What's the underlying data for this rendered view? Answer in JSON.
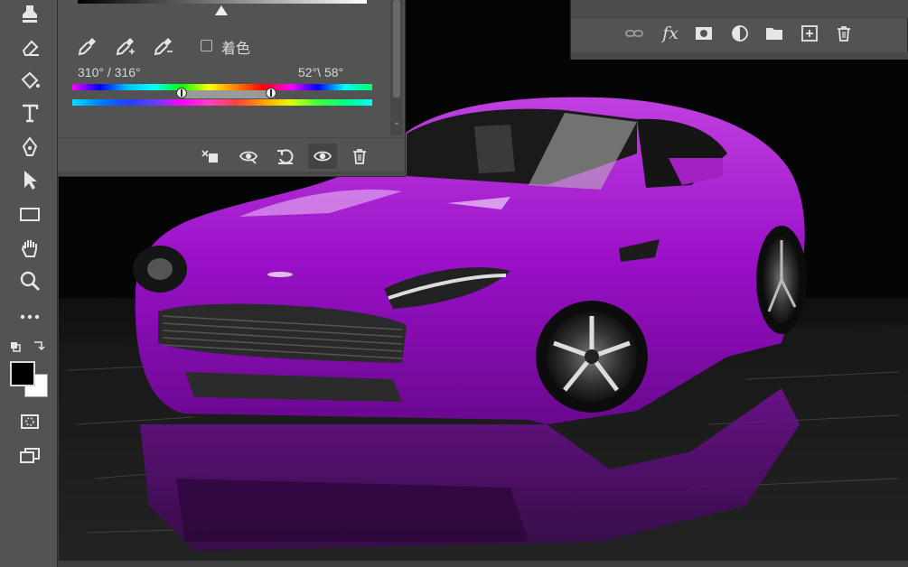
{
  "toolbar": {
    "tools": [
      "stamp-tool",
      "eraser-tool",
      "paint-bucket-tool",
      "type-tool",
      "pen-tool",
      "path-selection-tool",
      "rectangle-tool",
      "hand-tool",
      "zoom-tool",
      "more-tools",
      "swap-colors",
      "foreground-background-colors",
      "quick-mask",
      "screen-mode"
    ],
    "foreground_color": "#000000",
    "background_color": "#ffffff"
  },
  "properties_panel": {
    "colorize_label": "着色",
    "colorize_checked": false,
    "range_left_text": "310° / 316°",
    "range_right_text": "52°\\ 58°",
    "footer_buttons": [
      "clip-to-layer",
      "view-previous-state",
      "reset-to-defaults",
      "toggle-visibility",
      "delete-adjustment"
    ]
  },
  "layers_panel": {
    "buttons": [
      "link-layers",
      "fx",
      "add-mask",
      "new-fill-adjustment-layer",
      "new-group",
      "new-layer",
      "delete-layer"
    ],
    "fx_label": "fx"
  },
  "canvas": {
    "car_color": "#a020c0",
    "background_color": "#050505"
  }
}
